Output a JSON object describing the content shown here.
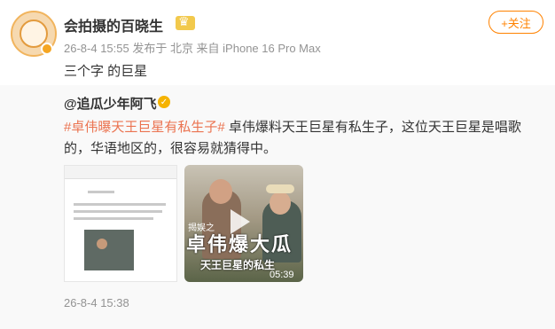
{
  "post": {
    "username": "会拍摄的百晓生",
    "meta": "26-8-4 15:55  发布于 北京  来自 iPhone 16 Pro Max",
    "follow_label": "+关注",
    "text": "三个字 的巨星"
  },
  "repost": {
    "author": "@追瓜少年阿飞",
    "hashtag": "#卓伟曝天王巨星有私生子#",
    "body": " 卓伟爆料天王巨星有私生子，这位天王巨星是唱歌的，华语地区的，很容易就猜得中。",
    "time": "26-8-4 15:38",
    "video": {
      "caption_small": "揭娱之",
      "caption_big": "卓伟爆大瓜",
      "caption_sub": "天王巨星的私生",
      "duration": "05:39"
    }
  },
  "colors": {
    "accent": "#ff8200",
    "hashtag": "#eb7350",
    "meta": "#939393",
    "repost_bg": "#f9f9f9"
  }
}
